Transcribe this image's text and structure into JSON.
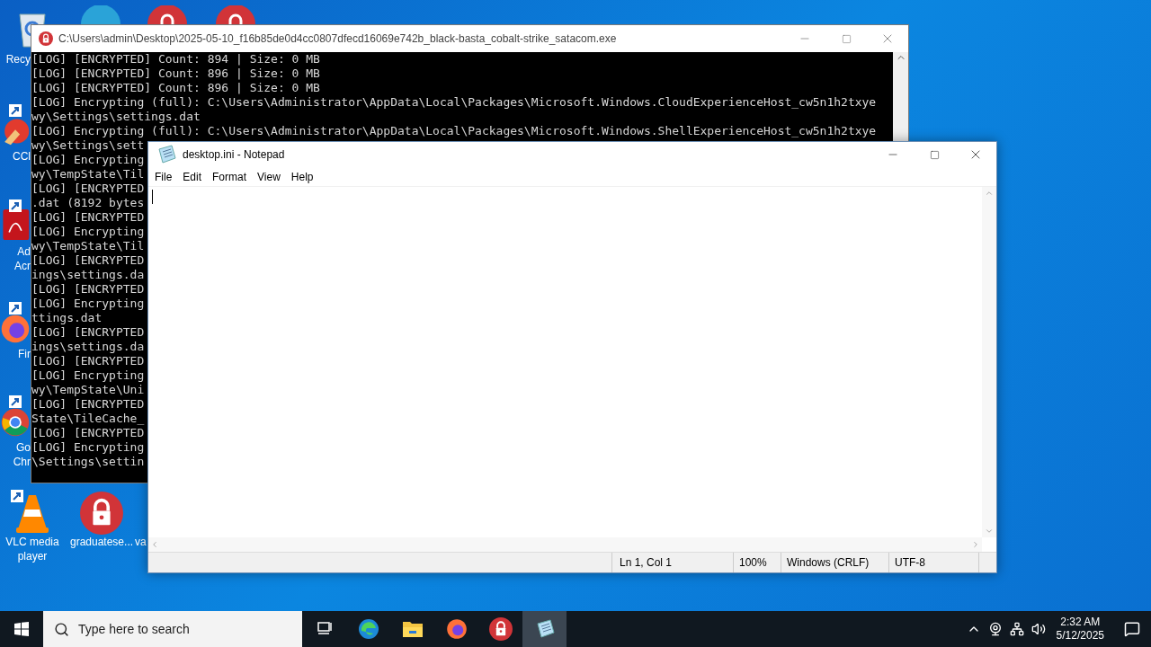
{
  "desktop_icons": [
    {
      "kind": "recycle",
      "label_lines": [
        "Recy"
      ]
    },
    {
      "kind": "ccleaner",
      "label_lines": [
        "CCl"
      ]
    },
    {
      "kind": "acrobat",
      "label_lines": [
        "Ad",
        "Acr"
      ]
    },
    {
      "kind": "firefox",
      "label_lines": [
        "Fir"
      ]
    },
    {
      "kind": "chrome",
      "label_lines": [
        "Go",
        "Chr"
      ]
    },
    {
      "kind": "vlc",
      "label_lines": [
        "VLC media",
        "player"
      ]
    },
    {
      "kind": "lock",
      "label_lines": [
        "graduatese..."
      ]
    },
    {
      "kind": "partial",
      "label_lines": [
        "va"
      ]
    }
  ],
  "console": {
    "title": "C:\\Users\\admin\\Desktop\\2025-05-10_f16b85de0d4cc0807dfecd16069e742b_black-basta_cobalt-strike_satacom.exe",
    "lines": [
      "[LOG] [ENCRYPTED] Count: 894 | Size: 0 MB",
      "[LOG] [ENCRYPTED] Count: 896 | Size: 0 MB",
      "[LOG] [ENCRYPTED] Count: 896 | Size: 0 MB",
      "[LOG] Encrypting (full): C:\\Users\\Administrator\\AppData\\Local\\Packages\\Microsoft.Windows.CloudExperienceHost_cw5n1h2txye",
      "wy\\Settings\\settings.dat",
      "[LOG] Encrypting (full): C:\\Users\\Administrator\\AppData\\Local\\Packages\\Microsoft.Windows.ShellExperienceHost_cw5n1h2txye",
      "wy\\Settings\\sett",
      "[LOG] Encrypting",
      "wy\\TempState\\Til",
      "[LOG] [ENCRYPTED",
      ".dat (8192 bytes",
      "[LOG] [ENCRYPTED",
      "[LOG] Encrypting",
      "wy\\TempState\\Til",
      "[LOG] [ENCRYPTED",
      "ings\\settings.da",
      "[LOG] [ENCRYPTED",
      "[LOG] Encrypting",
      "ttings.dat",
      "[LOG] [ENCRYPTED",
      "ings\\settings.da",
      "[LOG] [ENCRYPTED",
      "[LOG] Encrypting",
      "wy\\TempState\\Uni",
      "[LOG] [ENCRYPTED",
      "State\\TileCache_",
      "[LOG] [ENCRYPTED",
      "[LOG] Encrypting",
      "\\Settings\\settin"
    ]
  },
  "notepad": {
    "title": "desktop.ini - Notepad",
    "menu": [
      "File",
      "Edit",
      "Format",
      "View",
      "Help"
    ],
    "status": [
      "Ln 1, Col 1",
      "100%",
      "Windows (CRLF)",
      "UTF-8"
    ]
  },
  "taskbar": {
    "search_placeholder": "Type here to search",
    "apps": [
      {
        "kind": "taskview",
        "selected": false
      },
      {
        "kind": "edge",
        "selected": false
      },
      {
        "kind": "explorer",
        "selected": false
      },
      {
        "kind": "firefox",
        "selected": false
      },
      {
        "kind": "lock",
        "selected": false
      },
      {
        "kind": "notepad",
        "selected": true
      }
    ],
    "time": "2:32 AM",
    "date": "5/12/2025"
  }
}
